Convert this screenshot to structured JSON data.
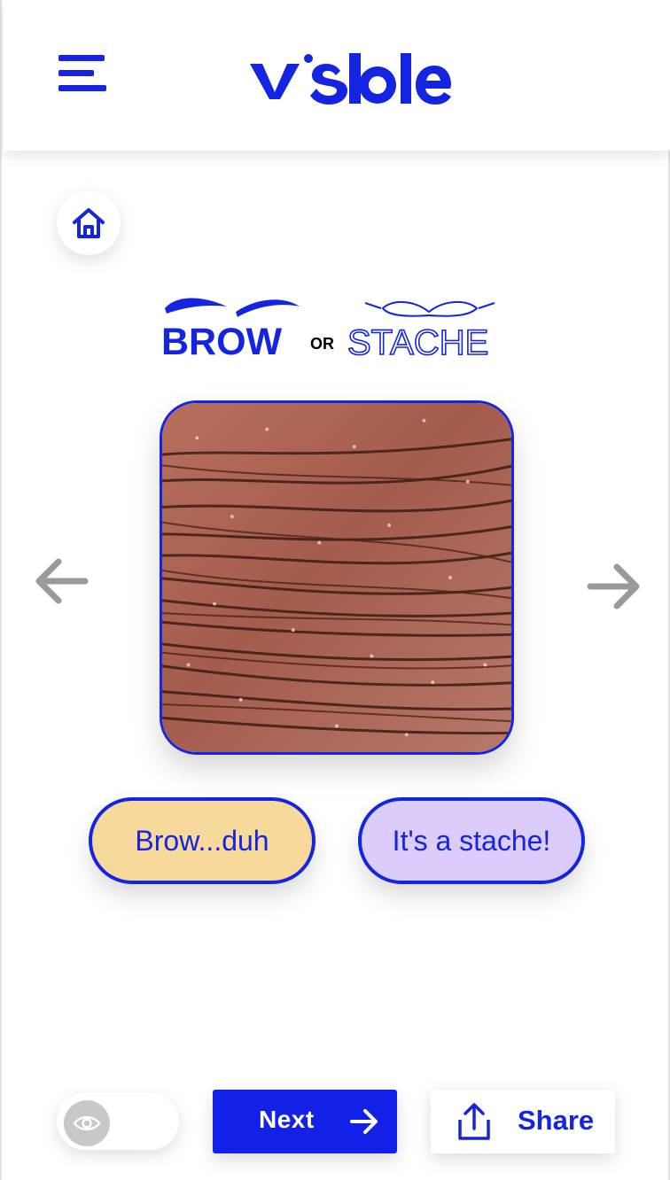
{
  "header": {
    "logo_text": "v·s·ble",
    "menu_icon": "hamburger-menu-icon"
  },
  "home": {
    "icon": "home-icon"
  },
  "game": {
    "title_left": "BROW",
    "title_joiner": "OR",
    "title_right": "STACHE"
  },
  "carousel": {
    "prev_icon": "arrow-left-icon",
    "next_icon": "arrow-right-icon",
    "image": "close-up of hair on skin"
  },
  "choices": {
    "brow_label": "Brow...duh",
    "stache_label": "It's a stache!"
  },
  "footer": {
    "visibility_toggle_icon": "eye-icon",
    "next_label": "Next",
    "share_label": "Share"
  },
  "colors": {
    "brand_blue": "#1524e0",
    "brow_button": "#f8d99c",
    "stache_button": "#dcccfc",
    "arrow_gray": "#9a9a9a"
  }
}
